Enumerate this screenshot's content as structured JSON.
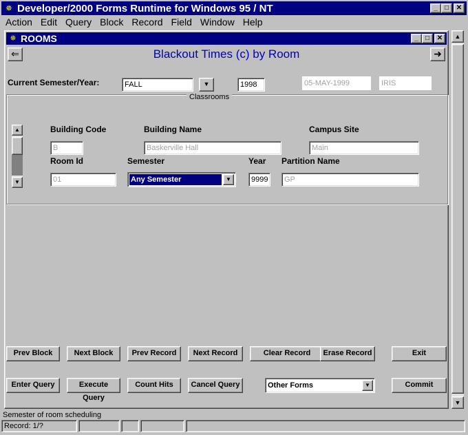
{
  "app": {
    "title": "Developer/2000 Forms Runtime for Windows 95 / NT",
    "window_buttons": {
      "minimize": "_",
      "maximize": "□",
      "close": "✕"
    }
  },
  "menu": [
    "Action",
    "Edit",
    "Query",
    "Block",
    "Record",
    "Field",
    "Window",
    "Help"
  ],
  "rooms_window": {
    "title": "ROOMS",
    "form_title": "Blackout Times (c) by Room",
    "nav_back": "⇐",
    "nav_forward": "➜"
  },
  "header": {
    "semester_label": "Current Semester/Year:",
    "semester_value": "FALL",
    "dropdown_glyph": "▼",
    "year_value": "1998",
    "date_value": "05-MAY-1999",
    "user_value": "IRIS"
  },
  "classrooms": {
    "caption": "Classrooms",
    "building_code_label": "Building Code",
    "building_code_value": "B",
    "building_name_label": "Building Name",
    "building_name_value": "Baskerville Hall",
    "campus_site_label": "Campus Site",
    "campus_site_value": "Main",
    "room_id_label": "Room Id",
    "room_id_value": "01",
    "semester_label": "Semester",
    "semester_value": "Any Semester",
    "year_label": "Year",
    "year_value": "9999",
    "partition_label": "Partition Name",
    "partition_value": "GP"
  },
  "buttons": {
    "prev_block": "Prev Block",
    "next_block": "Next Block",
    "prev_record": "Prev Record",
    "next_record": "Next Record",
    "clear_record": "Clear Record",
    "erase_record": "Erase Record",
    "exit": "Exit",
    "enter_query": "Enter Query",
    "execute_query": "Execute Query",
    "count_hits": "Count Hits",
    "cancel_query": "Cancel Query",
    "other_forms": "Other Forms",
    "commit": "Commit"
  },
  "status": {
    "message": "Semester of room scheduling",
    "record": "Record: 1/?"
  }
}
